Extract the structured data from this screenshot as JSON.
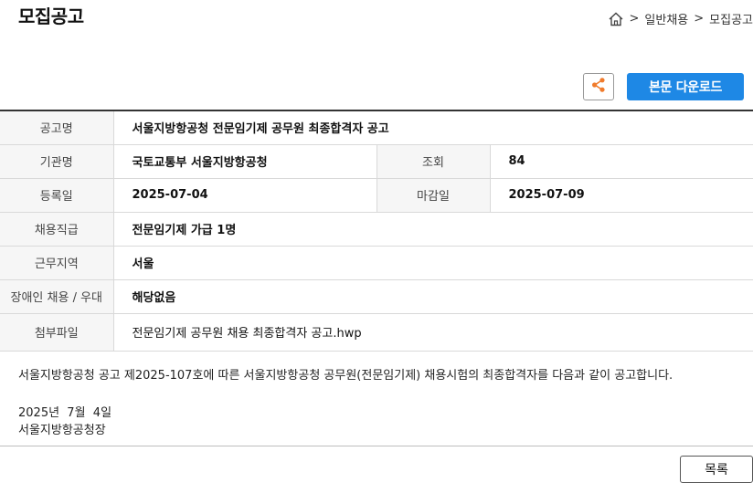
{
  "page": {
    "title": "모집공고"
  },
  "breadcrumb": {
    "items": [
      "일반채용",
      "모집공고"
    ],
    "separator": ">"
  },
  "actions": {
    "share_icon": "share-icon",
    "download_label": "본문 다운로드",
    "download_color": "#1e88e5",
    "share_color": "#f07b2c"
  },
  "details": {
    "title_label": "공고명",
    "title_value": "서울지방항공청 전문임기제 공무원 최종합격자 공고",
    "agency_label": "기관명",
    "agency_value": "국토교통부 서울지방항공청",
    "views_label": "조회",
    "views_value": "84",
    "registered_label": "등록일",
    "registered_value": "2025-07-04",
    "deadline_label": "마감일",
    "deadline_value": "2025-07-09",
    "position_label": "채용직급",
    "position_value": "전문임기제 가급 1명",
    "location_label": "근무지역",
    "location_value": "서울",
    "disability_label": "장애인 채용 / 우대",
    "disability_value": "해당없음",
    "attachment_label": "첨부파일",
    "attachment_value": "전문임기제 공무원 채용 최종합격자 공고.hwp"
  },
  "content": {
    "line1": "서울지방항공청 공고 제2025-107호에 따른 서울지방항공청 공무원(전문임기제) 채용시험의 최종합격자를 다음과 같이 공고합니다.",
    "date": "2025년  7월  4일",
    "signature": "서울지방항공청장"
  },
  "footer": {
    "list_label": "목록"
  }
}
